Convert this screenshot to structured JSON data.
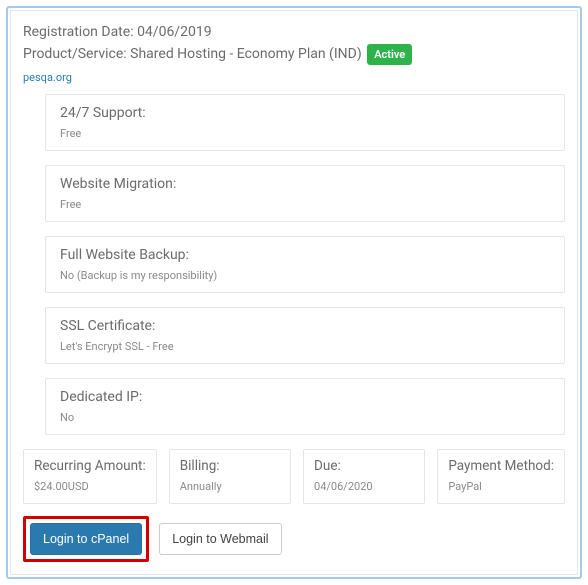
{
  "header": {
    "registration_label": "Registration Date:",
    "registration_value": "04/06/2019",
    "product_label": "Product/Service:",
    "product_value": "Shared Hosting - Economy Plan (IND)",
    "status_badge": "Active",
    "domain": "pesqa.org"
  },
  "features": [
    {
      "title": "24/7 Support:",
      "value": "Free"
    },
    {
      "title": "Website Migration:",
      "value": "Free"
    },
    {
      "title": "Full Website Backup:",
      "value": "No (Backup is my responsibility)"
    },
    {
      "title": "SSL Certificate:",
      "value": "Let's Encrypt SSL - Free"
    },
    {
      "title": "Dedicated IP:",
      "value": "No"
    }
  ],
  "summary": {
    "recurring": {
      "title": "Recurring Amount:",
      "value": "$24.00USD"
    },
    "billing": {
      "title": "Billing:",
      "value": "Annually"
    },
    "due": {
      "title": "Due:",
      "value": "04/06/2020"
    },
    "payment": {
      "title": "Payment Method:",
      "value": "PayPal"
    }
  },
  "buttons": {
    "cpanel": "Login to cPanel",
    "webmail": "Login to Webmail"
  }
}
